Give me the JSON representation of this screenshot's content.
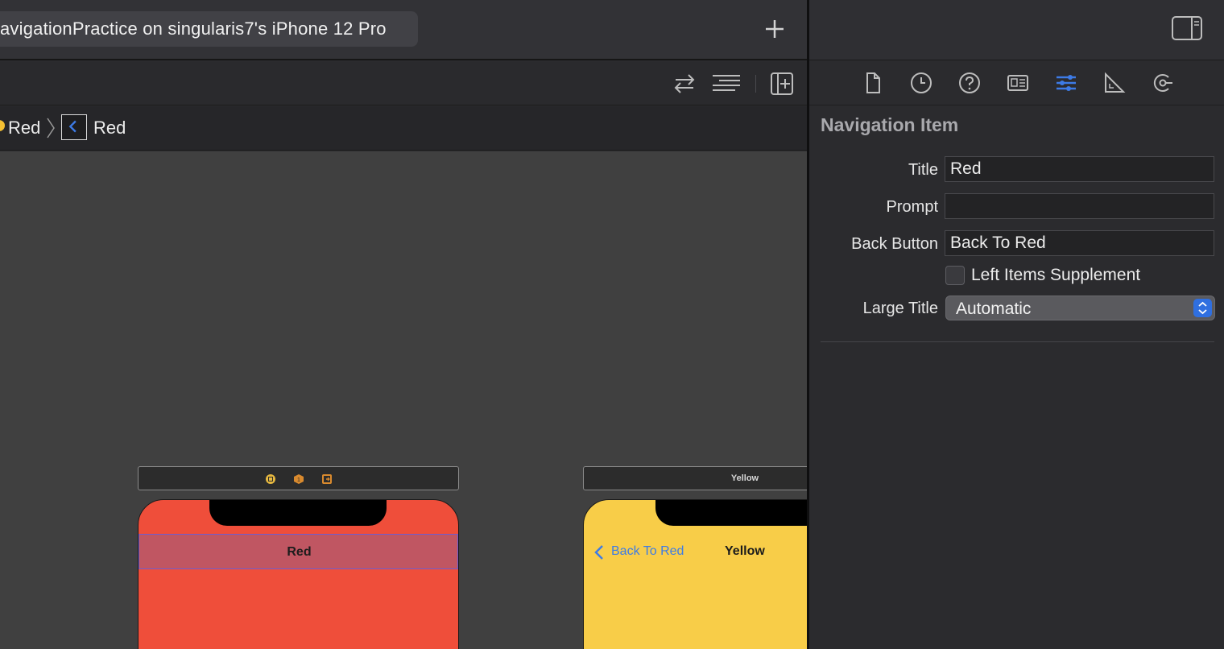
{
  "titlebar": {
    "scheme_label": "avigationPractice on singularis7's iPhone 12 Pro",
    "add_icon": "plus-icon"
  },
  "toolbar": {
    "icons": [
      "swap-arrows-icon",
      "align-lines-icon",
      "add-editor-icon"
    ]
  },
  "jumpbar": {
    "scene_label": "Red",
    "item_label": "Red",
    "scene_icon": "scene-dot-icon",
    "item_icon": "navigation-item-icon"
  },
  "canvas": {
    "red_scene": {
      "nav_title": "Red",
      "dock_icons": [
        "view-controller-icon",
        "first-responder-icon",
        "exit-icon"
      ]
    },
    "yellow_scene": {
      "dock_label": "Yellow",
      "back_label": "Back To Red",
      "nav_title": "Yellow"
    },
    "colors": {
      "red_scene": "#ef4e3a",
      "yellow_scene": "#f8cd48",
      "back_button": "#3d7be6"
    }
  },
  "inspector": {
    "tabs": [
      "file-icon",
      "history-icon",
      "help-icon",
      "identity-icon",
      "attributes-icon",
      "size-icon",
      "connections-icon"
    ],
    "active_tab": "attributes-icon",
    "section_title": "Navigation Item",
    "fields": {
      "title_label": "Title",
      "title_value": "Red",
      "prompt_label": "Prompt",
      "prompt_value": "",
      "back_button_label": "Back Button",
      "back_button_value": "Back To Red",
      "left_items_supplement_label": "Left Items Supplement",
      "left_items_supplement_checked": false,
      "large_title_label": "Large Title",
      "large_title_value": "Automatic"
    }
  }
}
